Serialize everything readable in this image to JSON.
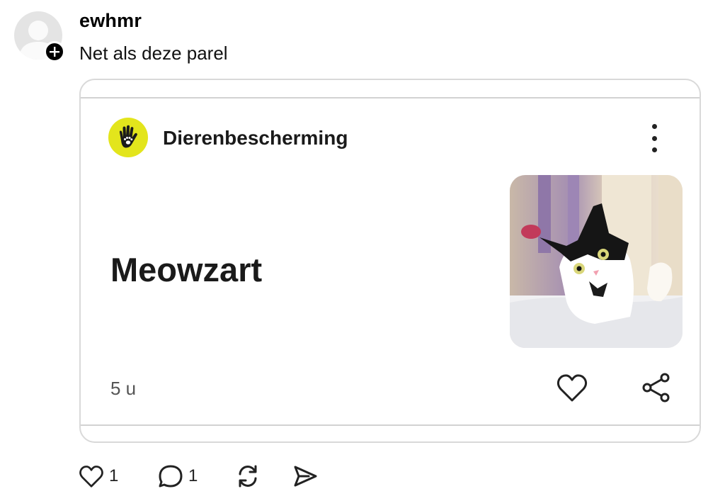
{
  "post": {
    "username": "ewhmr",
    "text": "Net als deze parel"
  },
  "card": {
    "brand_name": "Dierenbescherming",
    "headline": "Meowzart",
    "time": "5 u",
    "colors": {
      "brand_logo_bg": "#e3e51c"
    }
  },
  "actions": {
    "likes": "1",
    "comments": "1"
  },
  "icons": [
    "plus-icon",
    "more-icon",
    "heart-icon",
    "share-icon",
    "comment-icon",
    "repost-icon",
    "send-icon"
  ]
}
